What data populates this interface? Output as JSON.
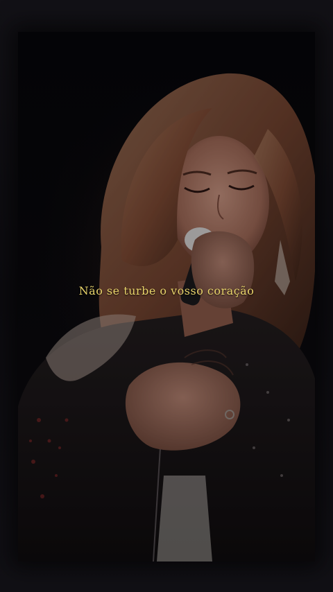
{
  "caption": {
    "text": "Não se turbe o vosso coração",
    "color": "#e8d36a"
  },
  "scene": {
    "subject": "singer-with-microphone",
    "hand": "hand-on-chest"
  }
}
